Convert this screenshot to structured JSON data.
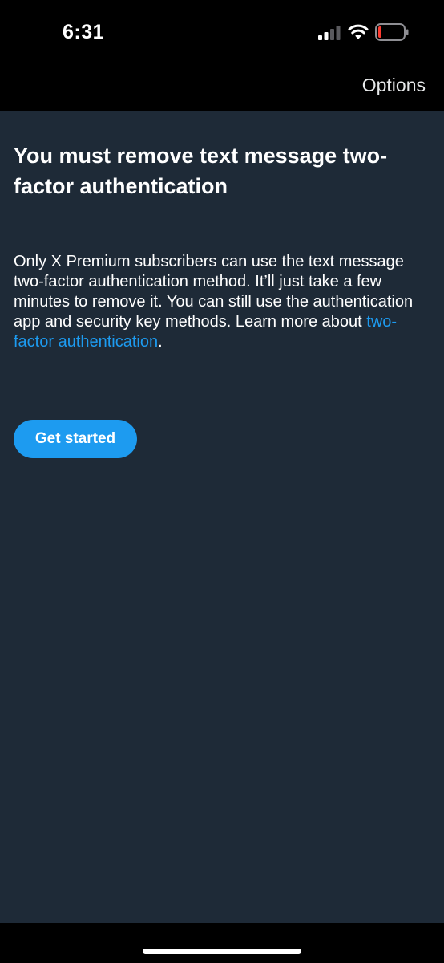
{
  "status_bar": {
    "time": "6:31",
    "icons": [
      "signal-icon",
      "wifi-icon",
      "battery-icon"
    ],
    "battery_color": "#ff3b30"
  },
  "nav": {
    "options_label": "Options"
  },
  "main": {
    "title": "You must remove text message two-factor authentication",
    "description_text": "Only X Premium subscribers can use the text message two-factor authentication method. It’ll just take a few minutes to remove it. You can still use the authentication app and security key methods. Learn more about ",
    "description_link": "two-factor authentication",
    "description_end": ".",
    "button_label": "Get started"
  },
  "colors": {
    "background": "#1e2a37",
    "accent": "#1d9bf0",
    "text": "#ffffff"
  }
}
